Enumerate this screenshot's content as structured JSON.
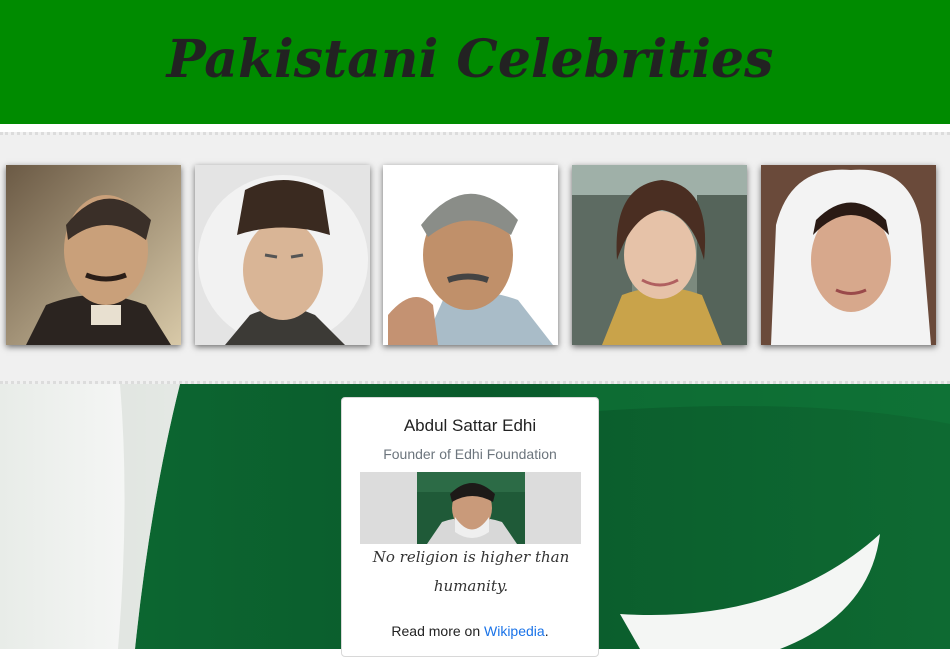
{
  "header": {
    "title": "Pakistani Celebrities",
    "background_color": "#008b00"
  },
  "gallery": {
    "items": [
      {
        "icon": "portrait-1"
      },
      {
        "icon": "portrait-2"
      },
      {
        "icon": "portrait-3"
      },
      {
        "icon": "portrait-4"
      },
      {
        "icon": "portrait-5"
      }
    ]
  },
  "card": {
    "name": "Abdul Sattar Edhi",
    "role": "Founder of Edhi Foundation",
    "quote": "No religion is higher than humanity.",
    "read_more_prefix": "Read more on ",
    "link_label": "Wikipedia",
    "read_more_suffix": "."
  },
  "colors": {
    "accent_green": "#008b00",
    "flag_green": "#0b5a2a",
    "link": "#1a73e8"
  }
}
